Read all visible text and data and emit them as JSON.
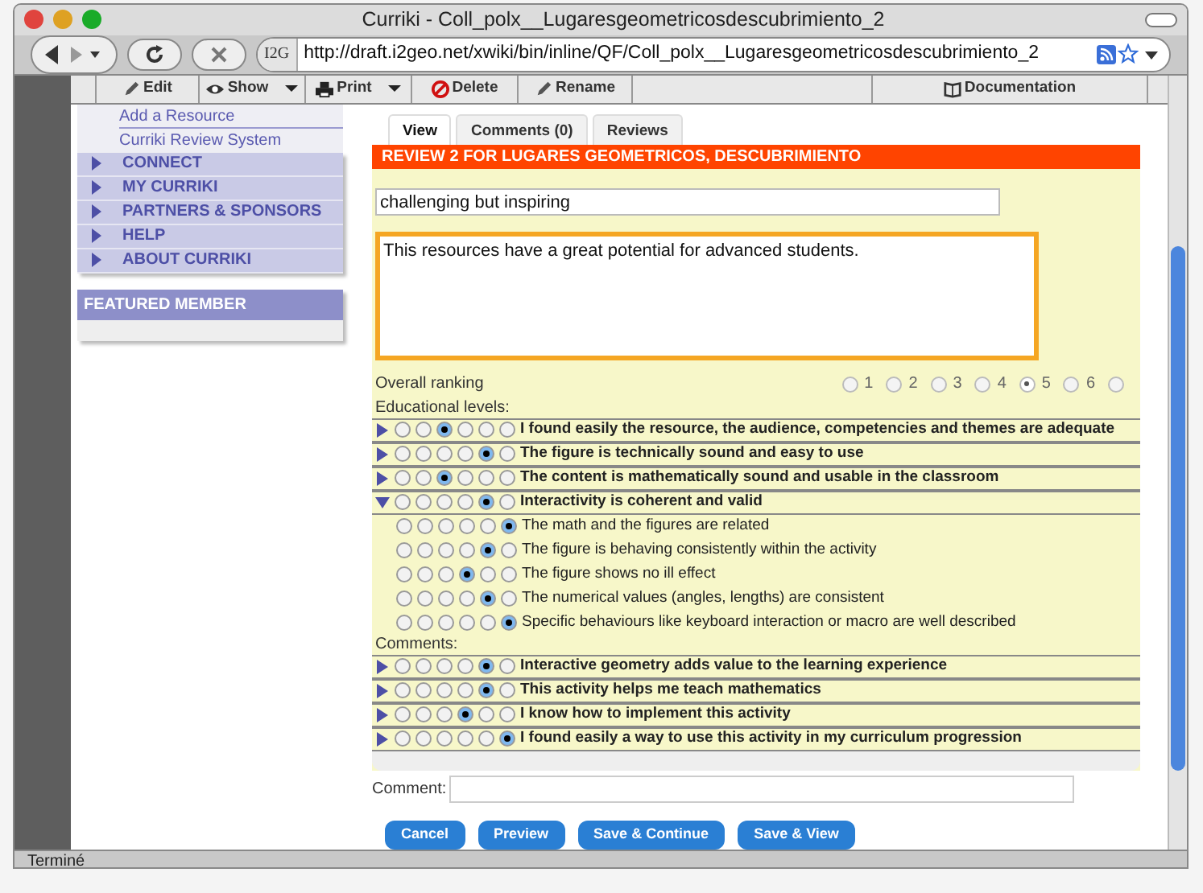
{
  "window": {
    "title": "Curriki - Coll_polx__Lugaresgeometricosdescubrimiento_2"
  },
  "toolbar": {
    "site_badge": "I2G",
    "url": "http://draft.i2geo.net/xwiki/bin/inline/QF/Coll_polx__Lugaresgeometricosdescubrimiento_2"
  },
  "edit_menu": [
    {
      "label": "Edit",
      "kind": "pencil",
      "dropdown": false
    },
    {
      "label": "Show",
      "kind": "eye",
      "dropdown": true
    },
    {
      "label": "Print",
      "kind": "printer",
      "dropdown": true
    },
    {
      "label": "Delete",
      "kind": "delete",
      "dropdown": false
    },
    {
      "label": "Rename",
      "kind": "pencil",
      "dropdown": false
    },
    {
      "label": "Documentation",
      "kind": "book",
      "dropdown": false
    }
  ],
  "sidebar": {
    "links": [
      "Add a Resource",
      "Curriki Review System"
    ],
    "nav": [
      "CONNECT",
      "MY CURRIKI",
      "PARTNERS & SPONSORS",
      "HELP",
      "ABOUT CURRIKI"
    ],
    "featured": "FEATURED MEMBER"
  },
  "tabs": [
    {
      "label": "View",
      "selected": true
    },
    {
      "label": "Comments (0)",
      "selected": false
    },
    {
      "label": "Reviews",
      "selected": false
    }
  ],
  "review": {
    "heading": "REVIEW 2 FOR LUGARES GEOMETRICOS, DESCUBRIMIENTO",
    "title": "challenging but inspiring",
    "body": "This resources have a great potential for advanced students.",
    "ranking": {
      "label": "Overall ranking",
      "options": [
        {
          "label": "1",
          "selected": false
        },
        {
          "label": "2",
          "selected": false
        },
        {
          "label": "3",
          "selected": false
        },
        {
          "label": "4",
          "selected": false
        },
        {
          "label": "5",
          "selected": true
        },
        {
          "label": "6",
          "selected": false
        },
        {
          "selected": false
        }
      ]
    },
    "sections": [
      {
        "label": "Educational levels:",
        "criteria": [
          {
            "text": "I found easily the resource, the audience, competencies and themes are adequate",
            "expanded": false,
            "options": [
              {
                "selected": false
              },
              {
                "selected": false
              },
              {
                "selected": true
              },
              {
                "selected": false
              },
              {
                "selected": false
              },
              {
                "selected": false
              }
            ]
          },
          {
            "text": "The figure is technically sound and easy to use",
            "expanded": false,
            "options": [
              {
                "selected": false
              },
              {
                "selected": false
              },
              {
                "selected": false
              },
              {
                "selected": false
              },
              {
                "selected": true
              },
              {
                "selected": false
              }
            ]
          },
          {
            "text": "The content is mathematically sound and usable in the classroom",
            "expanded": false,
            "options": [
              {
                "selected": false
              },
              {
                "selected": false
              },
              {
                "selected": true
              },
              {
                "selected": false
              },
              {
                "selected": false
              },
              {
                "selected": false
              }
            ]
          },
          {
            "text": "Interactivity is coherent and valid",
            "expanded": true,
            "options": [
              {
                "selected": false
              },
              {
                "selected": false
              },
              {
                "selected": false
              },
              {
                "selected": false
              },
              {
                "selected": true
              },
              {
                "selected": false
              }
            ],
            "children": [
              {
                "text": "The math and the figures are related",
                "options": [
                  {
                    "selected": false
                  },
                  {
                    "selected": false
                  },
                  {
                    "selected": false
                  },
                  {
                    "selected": false
                  },
                  {
                    "selected": false
                  },
                  {
                    "selected": true
                  }
                ]
              },
              {
                "text": "The figure is behaving consistently within the activity",
                "options": [
                  {
                    "selected": false
                  },
                  {
                    "selected": false
                  },
                  {
                    "selected": false
                  },
                  {
                    "selected": false
                  },
                  {
                    "selected": true
                  },
                  {
                    "selected": false
                  }
                ]
              },
              {
                "text": "The figure shows no ill effect",
                "options": [
                  {
                    "selected": false
                  },
                  {
                    "selected": false
                  },
                  {
                    "selected": false
                  },
                  {
                    "selected": true
                  },
                  {
                    "selected": false
                  },
                  {
                    "selected": false
                  }
                ]
              },
              {
                "text": "The numerical values (angles, lengths) are consistent",
                "options": [
                  {
                    "selected": false
                  },
                  {
                    "selected": false
                  },
                  {
                    "selected": false
                  },
                  {
                    "selected": false
                  },
                  {
                    "selected": true
                  },
                  {
                    "selected": false
                  }
                ]
              },
              {
                "text": "Specific behaviours like keyboard interaction or macro are well described",
                "options": [
                  {
                    "selected": false
                  },
                  {
                    "selected": false
                  },
                  {
                    "selected": false
                  },
                  {
                    "selected": false
                  },
                  {
                    "selected": false
                  },
                  {
                    "selected": true
                  }
                ]
              }
            ]
          }
        ]
      },
      {
        "label": "Comments:",
        "criteria": [
          {
            "text": "Interactive geometry adds value to the learning experience",
            "expanded": false,
            "options": [
              {
                "selected": false
              },
              {
                "selected": false
              },
              {
                "selected": false
              },
              {
                "selected": false
              },
              {
                "selected": true
              },
              {
                "selected": false
              }
            ]
          },
          {
            "text": "This activity helps me teach mathematics",
            "expanded": false,
            "options": [
              {
                "selected": false
              },
              {
                "selected": false
              },
              {
                "selected": false
              },
              {
                "selected": false
              },
              {
                "selected": true
              },
              {
                "selected": false
              }
            ]
          },
          {
            "text": "I know how to implement this activity",
            "expanded": false,
            "options": [
              {
                "selected": false
              },
              {
                "selected": false
              },
              {
                "selected": false
              },
              {
                "selected": true
              },
              {
                "selected": false
              },
              {
                "selected": false
              }
            ]
          },
          {
            "text": "I found easily a way to use this activity in my curriculum progression",
            "expanded": false,
            "options": [
              {
                "selected": false
              },
              {
                "selected": false
              },
              {
                "selected": false
              },
              {
                "selected": false
              },
              {
                "selected": false
              },
              {
                "selected": true
              }
            ]
          }
        ]
      }
    ],
    "comment_label": "Comment:"
  },
  "buttons": [
    "Cancel",
    "Preview",
    "Save & Continue",
    "Save & View"
  ],
  "status_bar": "Terminé"
}
